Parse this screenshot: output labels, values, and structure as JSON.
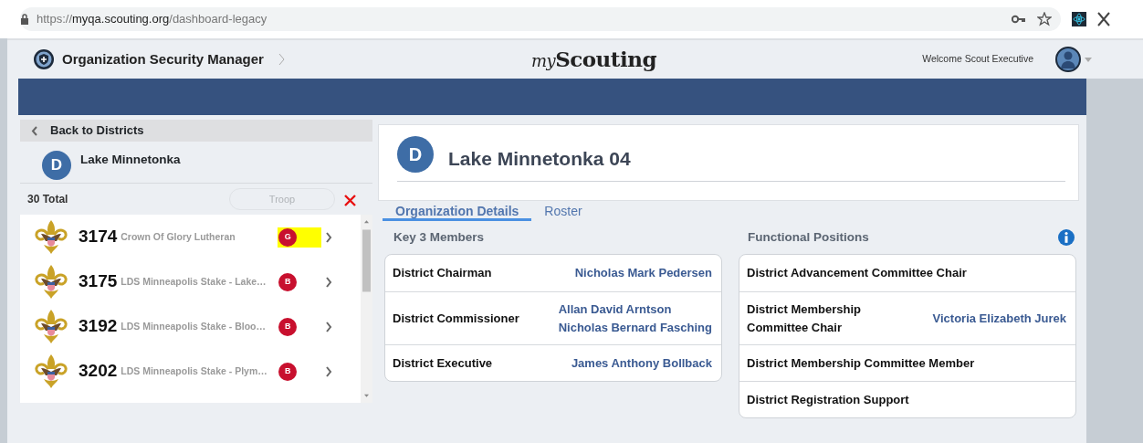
{
  "browser": {
    "url": "https://**myqa.scouting.org**/dashboard-legacy"
  },
  "header": {
    "app_title": "Organization Security Manager",
    "logo_prefix": "my",
    "logo_name": "Scouting",
    "welcome": "Welcome Scout Executive"
  },
  "sidebar": {
    "back_label": "Back to Districts",
    "district": {
      "initial": "D",
      "name": "Lake Minnetonka"
    },
    "total": "30 Total",
    "search": {
      "placeholder": "Troop"
    },
    "units": [
      {
        "number": "3174",
        "name": "Crown Of Glory Lutheran",
        "badge": "G",
        "highlighted": true
      },
      {
        "number": "3175",
        "name": "LDS Minneapolis Stake - Lake…",
        "badge": "B",
        "highlighted": false
      },
      {
        "number": "3192",
        "name": "LDS Minneapolis Stake - Bloo…",
        "badge": "B",
        "highlighted": false
      },
      {
        "number": "3202",
        "name": "LDS Minneapolis Stake - Plym…",
        "badge": "B",
        "highlighted": false
      }
    ]
  },
  "main": {
    "initial": "D",
    "title": "Lake Minnetonka 04",
    "tabs": [
      {
        "label": "Organization Details",
        "selected": true
      },
      {
        "label": "Roster",
        "selected": false
      }
    ],
    "key3": {
      "heading": "Key 3 Members",
      "rows": [
        {
          "position": "District Chairman",
          "names": [
            "Nicholas Mark Pedersen"
          ]
        },
        {
          "position": "District Commissioner",
          "names": [
            "Allan David Arntson",
            "Nicholas Bernard Fasching"
          ]
        },
        {
          "position": "District Executive",
          "names": [
            "James Anthony Bollback"
          ]
        }
      ]
    },
    "functional": {
      "heading": "Functional Positions",
      "rows": [
        {
          "position": "District Advancement Committee Chair",
          "names": []
        },
        {
          "position": "District Membership Committee Chair",
          "names": [
            "Victoria Elizabeth Jurek"
          ]
        },
        {
          "position": "District Membership Committee Member",
          "names": []
        },
        {
          "position": "District Registration Support",
          "names": []
        }
      ]
    }
  }
}
